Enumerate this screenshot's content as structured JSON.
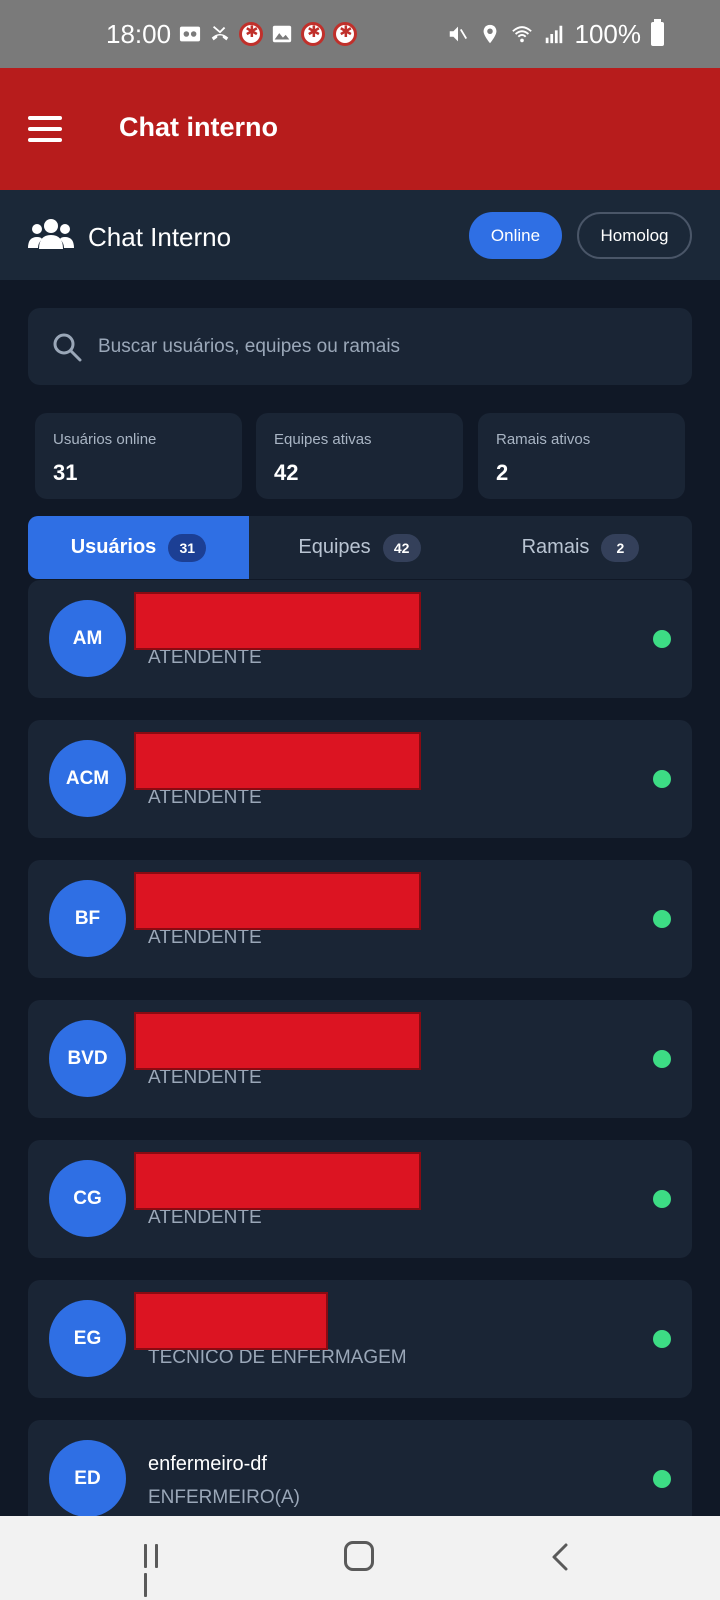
{
  "status_bar": {
    "time": "18:00",
    "battery": "100%"
  },
  "app_bar": {
    "title": "Chat interno",
    "menu_icon": "hamburger-menu-icon"
  },
  "header": {
    "title": "Chat Interno",
    "icon": "users-group-icon",
    "status_online": "Online",
    "environment": "Homolog"
  },
  "search": {
    "placeholder": "Buscar usuários, equipes ou ramais"
  },
  "stats": [
    {
      "label": "Usuários online",
      "value": "31"
    },
    {
      "label": "Equipes ativas",
      "value": "42"
    },
    {
      "label": "Ramais ativos",
      "value": "2"
    }
  ],
  "tabs": [
    {
      "label": "Usuários",
      "count": "31",
      "active": true
    },
    {
      "label": "Equipes",
      "count": "42",
      "active": false
    },
    {
      "label": "Ramais",
      "count": "2",
      "active": false
    }
  ],
  "users": [
    {
      "initials": "AM",
      "name": "",
      "role": "ATENDENTE",
      "redacted": true,
      "status": "online"
    },
    {
      "initials": "ACM",
      "name": "",
      "role": "ATENDENTE",
      "redacted": true,
      "status": "online"
    },
    {
      "initials": "BF",
      "name": "",
      "role": "ATENDENTE",
      "redacted": true,
      "status": "online"
    },
    {
      "initials": "BVD",
      "name": "",
      "role": "ATENDENTE",
      "redacted": true,
      "status": "online"
    },
    {
      "initials": "CG",
      "name": "",
      "role": "ATENDENTE",
      "redacted": true,
      "status": "online"
    },
    {
      "initials": "EG",
      "name": "",
      "role": "TECNICO DE ENFERMAGEM",
      "redacted": true,
      "status": "online"
    },
    {
      "initials": "ED",
      "name": "enfermeiro-df",
      "role": "ENFERMEIRO(A)",
      "redacted": false,
      "status": "online"
    }
  ],
  "colors": {
    "app_bar": "#b71c1c",
    "accent": "#2f6fe4",
    "background": "#101826",
    "card": "#1a2535",
    "online": "#3ddc84"
  }
}
